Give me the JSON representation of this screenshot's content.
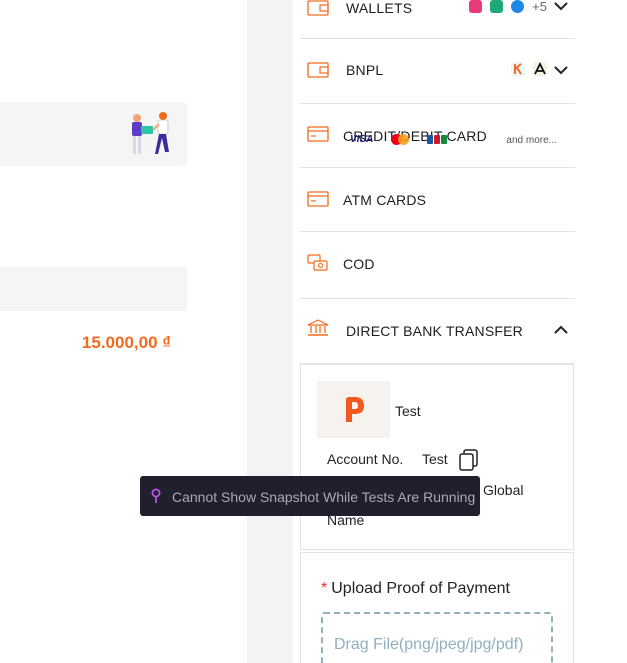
{
  "left": {
    "amount": "15.000,00 ₫"
  },
  "payment_methods": [
    {
      "label": "WALLETS",
      "extra_count": "+5",
      "chevron": "chevron-down-icon"
    },
    {
      "label": "BNPL",
      "chevron": "chevron-down-icon"
    },
    {
      "label": "CREDIT/DEBIT CARD",
      "card_brands": [
        "VISA",
        "Mastercard",
        "JCB"
      ],
      "more_text": "and more..."
    },
    {
      "label": "ATM CARDS"
    },
    {
      "label": "COD"
    },
    {
      "label": "DIRECT BANK TRANSFER",
      "chevron": "chevron-up-icon",
      "expanded": true
    }
  ],
  "bank": {
    "name": "Test",
    "account_label": "Account No.",
    "account_value": "Test",
    "holder_value": "Global",
    "holder_label": "Name"
  },
  "upload": {
    "required_mark": "*",
    "title": "Upload Proof of Payment",
    "dropzone_text": "Drag File(png/jpeg/jpg/pdf)"
  },
  "tooltip": {
    "text": "Cannot Show Snapshot While Tests Are Running"
  },
  "colors": {
    "accent": "#f26b1d",
    "tooltip_bg": "#1f1f2e",
    "dropzone": "#8fb0bf"
  }
}
